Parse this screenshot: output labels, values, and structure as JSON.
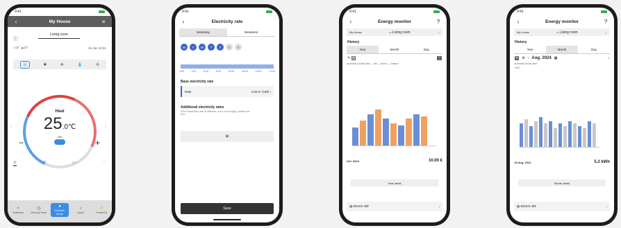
{
  "status_time": "9:41",
  "home": {
    "title": "My House",
    "room": "Living room",
    "indoor": "12°",
    "outdoor": "12°",
    "date": "26 Jan 10:51",
    "heat_label": "Heat",
    "temp_int": "25",
    "temp_dec": ".0℃",
    "on_label": "ON",
    "minus": "−",
    "plus": "+",
    "tabs": [
      "Statistics",
      "Weekly timer",
      "Comfort-Mode",
      "Quiet",
      "Powerful"
    ]
  },
  "rate": {
    "title": "Electricity rate",
    "segments": [
      "Weekday",
      "Weekend"
    ],
    "days": [
      "M",
      "T",
      "W",
      "T",
      "F",
      "S",
      "S"
    ],
    "times": [
      "0:00",
      "3:00",
      "6:00",
      "9:00",
      "12:00",
      "15:00",
      "18:00",
      "21:00"
    ],
    "base_header": "Base electricity rate",
    "rate_label": "Rate",
    "rate_value": "0.25 € / kWh",
    "additional_header": "Additional electricity rates",
    "additional_desc": "If the electricity rate is different, such as at night, please set this.",
    "add": "+",
    "save": "Save"
  },
  "monitor_year": {
    "title": "Energy monitor",
    "selector_home": "My House",
    "selector_room": "Living room",
    "history": "History",
    "segments": [
      "Year",
      "Month",
      "Day"
    ],
    "legend": "■ Heat ■ Cool ■ Other   — Set  — Indoor  — Outdoor",
    "period": "Oct. 2024",
    "value": "10.00 €",
    "detail": "Year detail",
    "bill": "Electric Bill"
  },
  "monitor_month": {
    "title": "Energy monitor",
    "selector_home": "My House",
    "selector_room": "Living room",
    "history": "History",
    "segments": [
      "Year",
      "Month",
      "Day"
    ],
    "date": "Aug. 2024",
    "legend": "■ Heat ■ Cool ■ Other",
    "unit": "kWh",
    "period": "15 Aug. 2024",
    "value": "5.2 kWh",
    "detail": "Month detail",
    "bill": "Electric Bill"
  }
}
